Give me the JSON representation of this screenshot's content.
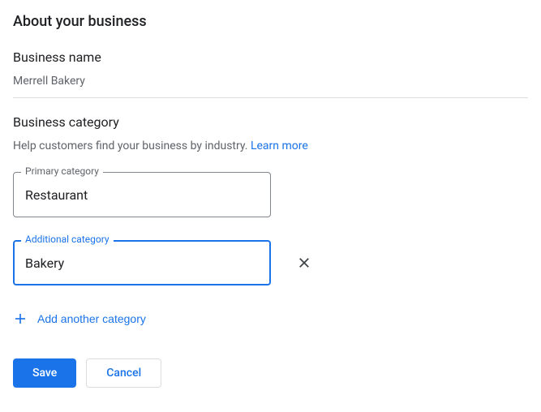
{
  "section_title": "About your business",
  "business_name": {
    "label": "Business name",
    "value": "Merrell Bakery"
  },
  "business_category": {
    "label": "Business category",
    "helper": "Help customers find your business by industry. ",
    "learn_more": "Learn more"
  },
  "primary_category": {
    "label": "Primary category",
    "value": "Restaurant"
  },
  "additional_category": {
    "label": "Additional category",
    "value": "Bakery"
  },
  "add_another": "Add another category",
  "buttons": {
    "save": "Save",
    "cancel": "Cancel"
  }
}
